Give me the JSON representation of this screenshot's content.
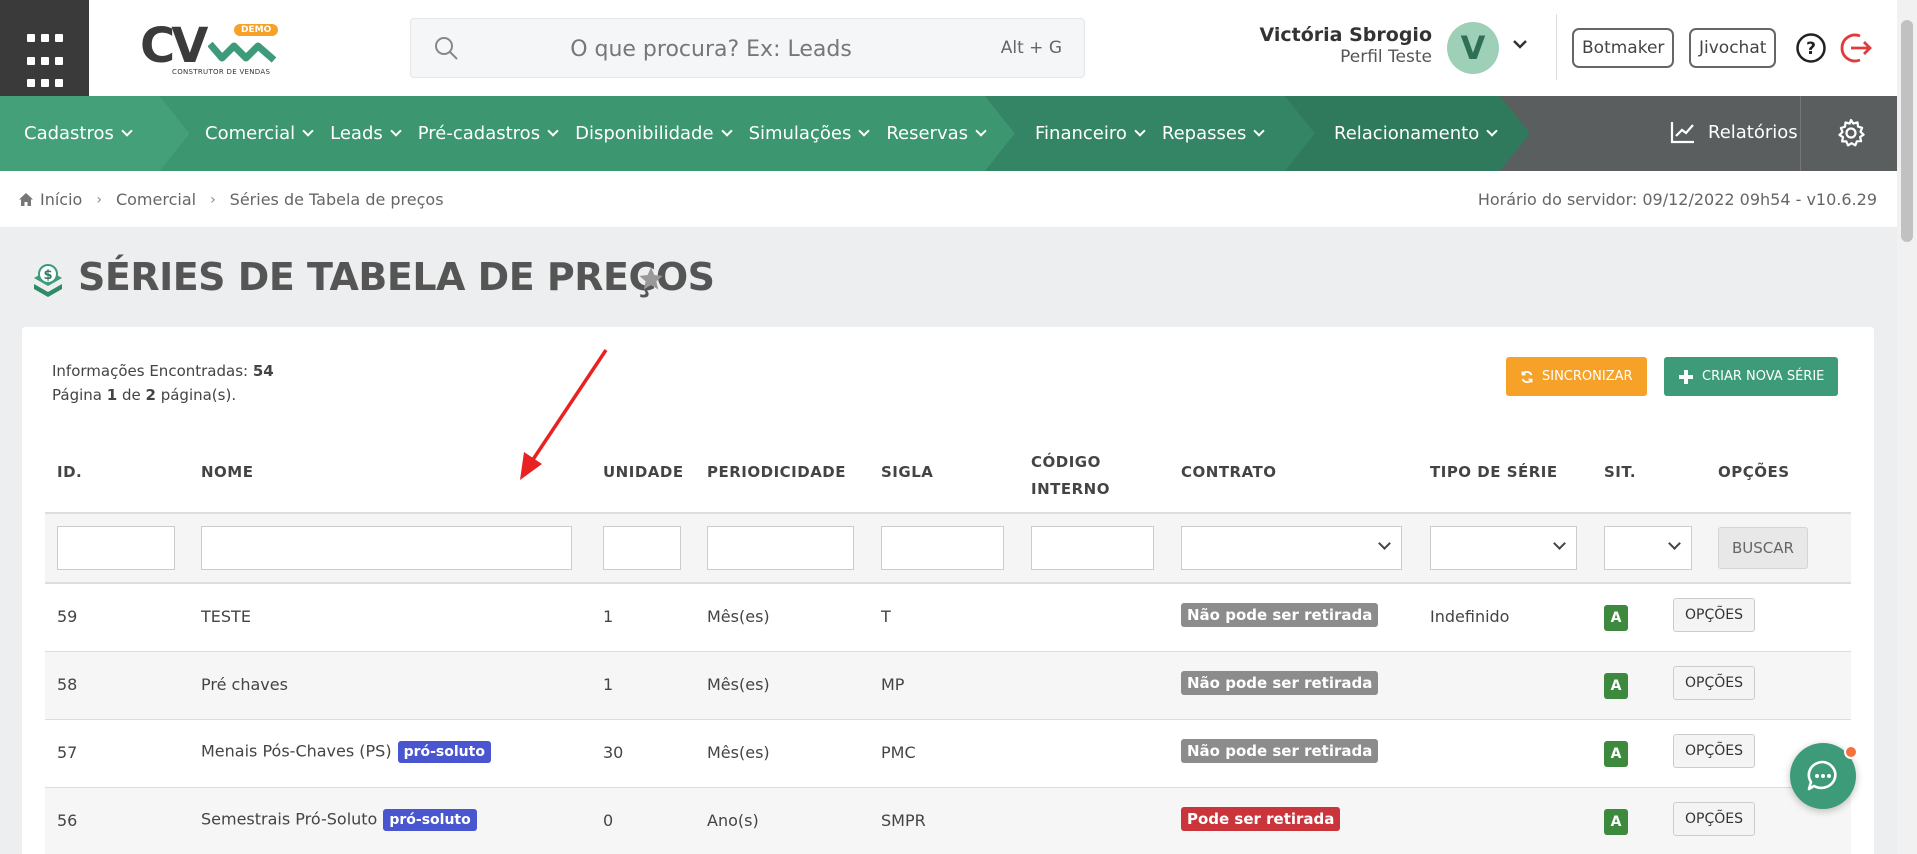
{
  "header": {
    "logo": {
      "brand": "CV",
      "badge": "DEMO",
      "subtitle": "CONSTRUTOR DE VENDAS"
    },
    "search": {
      "placeholder": "O que procura? Ex: Leads",
      "shortcut": "Alt + G"
    },
    "user": {
      "name": "Victória Sbrogio",
      "role": "Perfil Teste",
      "initial": "V"
    },
    "buttons": {
      "botmaker": "Botmaker",
      "jivochat": "Jivochat"
    }
  },
  "nav": {
    "groups": [
      {
        "items": [
          "Cadastros"
        ],
        "color": "#44a078"
      },
      {
        "items": [
          "Comercial",
          "Leads",
          "Pré-cadastros",
          "Disponibilidade",
          "Simulações",
          "Reservas"
        ],
        "color": "#3c9670"
      },
      {
        "items": [
          "Financeiro",
          "Repasses"
        ],
        "color": "#348565"
      },
      {
        "items": [
          "Relacionamento"
        ],
        "color": "#2f7a5c"
      }
    ],
    "reports": "Relatórios"
  },
  "breadcrumb": {
    "items": [
      "Início",
      "Comercial",
      "Séries de Tabela de preços"
    ],
    "server_time": "Horário do servidor: 09/12/2022 09h54 - v10.6.29"
  },
  "page": {
    "title": "SÉRIES DE TABELA DE PREÇOS"
  },
  "summary": {
    "found_label": "Informações Encontradas:",
    "found_count": "54",
    "page_label": "Página",
    "page_current": "1",
    "page_of": "de",
    "page_total": "2",
    "page_suffix": "página(s)."
  },
  "actions": {
    "sync": "SINCRONIZAR",
    "create": "CRIAR NOVA SÉRIE"
  },
  "table": {
    "headers": [
      "ID.",
      "NOME",
      "UNIDADE",
      "PERIODICIDADE",
      "SIGLA",
      "CÓDIGO",
      "INTERNO",
      "CONTRATO",
      "TIPO DE SÉRIE",
      "SIT.",
      "OPÇÕES"
    ],
    "search_button": "BUSCAR",
    "options_button": "OPÇÕES",
    "rows": [
      {
        "id": "59",
        "nome": "TESTE",
        "tag": "",
        "unidade": "1",
        "periodicidade": "Mês(es)",
        "sigla": "T",
        "contrato": "Não pode ser retirada",
        "contrato_color": "#8c8c8c",
        "tipo": "Indefinido",
        "sit": "A"
      },
      {
        "id": "58",
        "nome": "Pré chaves",
        "tag": "",
        "unidade": "1",
        "periodicidade": "Mês(es)",
        "sigla": "MP",
        "contrato": "Não pode ser retirada",
        "contrato_color": "#8c8c8c",
        "tipo": "",
        "sit": "A"
      },
      {
        "id": "57",
        "nome": "Menais Pós-Chaves (PS)",
        "tag": "pró-soluto",
        "unidade": "30",
        "periodicidade": "Mês(es)",
        "sigla": "PMC",
        "contrato": "Não pode ser retirada",
        "contrato_color": "#8c8c8c",
        "tipo": "",
        "sit": "A"
      },
      {
        "id": "56",
        "nome": "Semestrais Pró-Soluto",
        "tag": "pró-soluto",
        "unidade": "0",
        "periodicidade": "Ano(s)",
        "sigla": "SMPR",
        "contrato": "Pode ser retirada",
        "contrato_color": "#c9353a",
        "tipo": "",
        "sit": "A"
      }
    ]
  }
}
